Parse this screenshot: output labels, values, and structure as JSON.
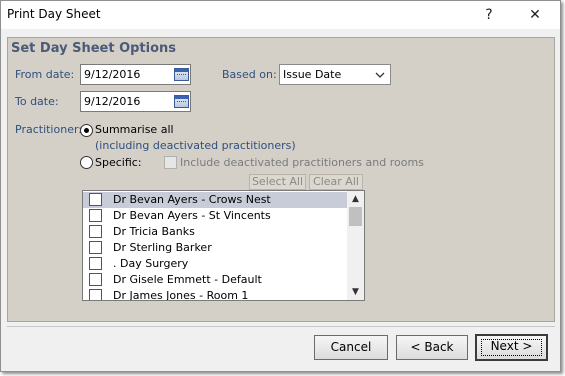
{
  "window": {
    "title": "Print Day Sheet",
    "help_glyph": "?",
    "close_glyph": "✕"
  },
  "options": {
    "heading": "Set Day Sheet Options",
    "from_date_label": "From date:",
    "from_date_value": "9/12/2016",
    "to_date_label": "To date:",
    "to_date_value": "9/12/2016",
    "based_on_label": "Based on:",
    "based_on_value": "Issue Date",
    "practitioner_label": "Practitioner:",
    "summarise_all_label": "Summarise all",
    "summarise_all_note": "(including deactivated practitioners)",
    "specific_label": "Specific:",
    "include_deactivated_label": "Include deactivated practitioners and rooms",
    "select_all_label": "Select All",
    "clear_all_label": "Clear All"
  },
  "practitioners": [
    {
      "name": "Dr Bevan Ayers - Crows Nest",
      "selected": true
    },
    {
      "name": "Dr Bevan Ayers - St Vincents",
      "selected": false
    },
    {
      "name": "Dr Tricia Banks",
      "selected": false
    },
    {
      "name": "Dr Sterling Barker",
      "selected": false
    },
    {
      "name": ". Day Surgery",
      "selected": false
    },
    {
      "name": "Dr Gisele Emmett - Default",
      "selected": false
    },
    {
      "name": "Dr James Jones - Room 1",
      "selected": false
    }
  ],
  "footer": {
    "cancel_label": "Cancel",
    "back_label": "< Back",
    "next_label": "Next >"
  },
  "colors": {
    "heading": "#4a5a78",
    "label": "#2f4f7f",
    "panel": "#d4d0c8"
  }
}
